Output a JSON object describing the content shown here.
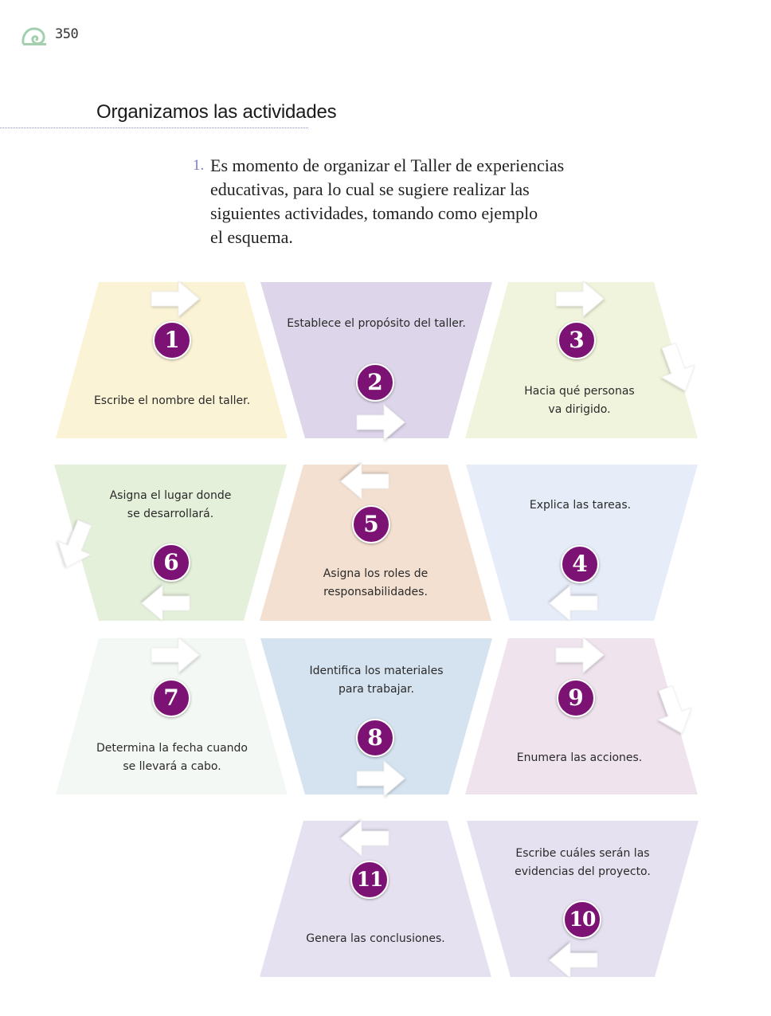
{
  "header": {
    "page_number": "350",
    "logo_icon": "snail-shell-icon",
    "logo_color": "#a3cfae"
  },
  "section_title": "Organizamos las actividades",
  "instruction": {
    "number": "1.",
    "text": "Es momento de organizar el Taller de experiencias\neducativas, para lo cual se sugiere realizar las\nsiguientes actividades, tomando como ejemplo\nel esquema."
  },
  "colors": {
    "badge": "#7b1274",
    "arrow": "#ffffff"
  },
  "steps": [
    {
      "number": "1",
      "text": "Escribe el nombre del taller.",
      "color": "#fbf3d6"
    },
    {
      "number": "2",
      "text": "Establece el propósito del taller.",
      "color": "#ddd5e9"
    },
    {
      "number": "3",
      "text": "Hacia qué personas\nva dirigido.",
      "color": "#f1f4dc"
    },
    {
      "number": "4",
      "text": "Explica las tareas.",
      "color": "#e6ecf8"
    },
    {
      "number": "5",
      "text": "Asigna los roles de\nresponsabilidades.",
      "color": "#f3e0d0"
    },
    {
      "number": "6",
      "text": "Asigna el lugar donde\nse desarrollará.",
      "color": "#e5f0db"
    },
    {
      "number": "7",
      "text": "Determina la fecha cuando\nse llevará a cabo.",
      "color": "#f4f8f4"
    },
    {
      "number": "8",
      "text": "Identifica los materiales\npara trabajar.",
      "color": "#d5e3f0"
    },
    {
      "number": "9",
      "text": "Enumera las acciones.",
      "color": "#efe3ee"
    },
    {
      "number": "10",
      "text": "Escribe cuáles serán las\nevidencias del proyecto.",
      "color": "#e5e1f0"
    },
    {
      "number": "11",
      "text": "Genera las conclusiones.",
      "color": "#e6e1f1"
    }
  ],
  "arrow_icon": "arrow-icon"
}
